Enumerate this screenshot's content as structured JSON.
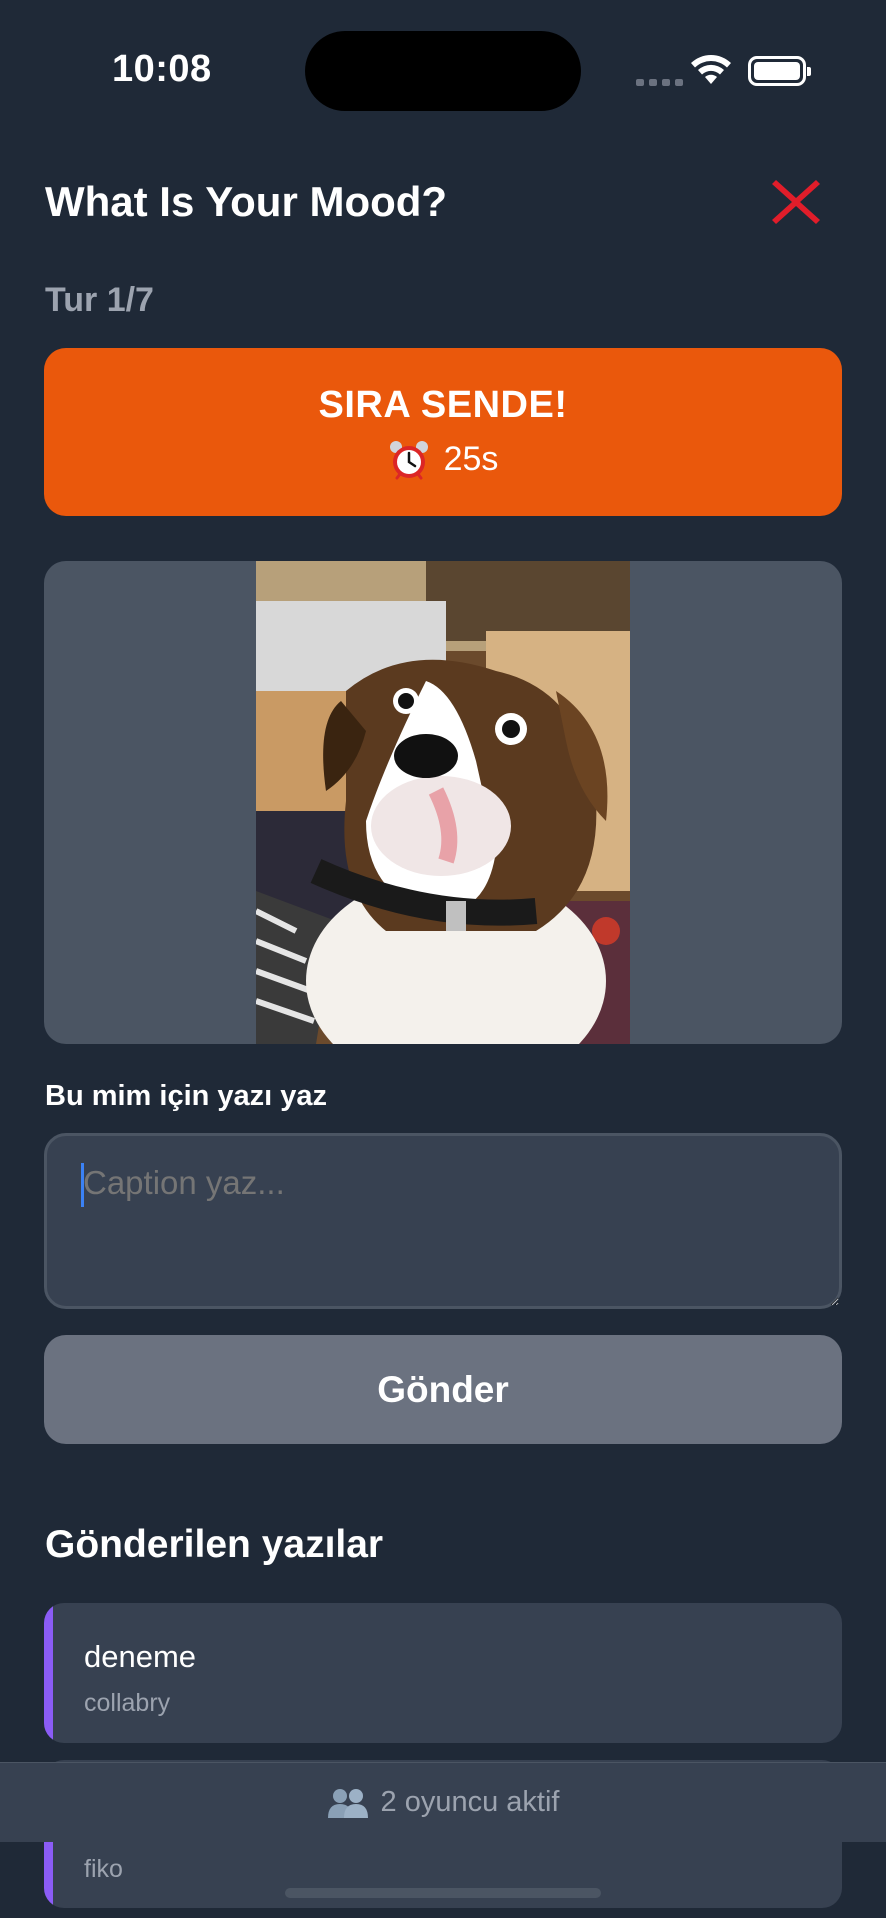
{
  "status_bar": {
    "time": "10:08"
  },
  "header": {
    "title": "What Is Your Mood?",
    "round": "Tur 1/7"
  },
  "turn": {
    "title": "SIRA SENDE!",
    "timer": "25s",
    "timer_icon": "alarm-clock-icon"
  },
  "meme": {
    "label": "Bu mim için yazı yaz"
  },
  "caption_input": {
    "placeholder": "Caption yaz...",
    "value": ""
  },
  "send_button": {
    "label": "Gönder"
  },
  "submitted": {
    "title": "Gönderilen yazılar",
    "items": [
      {
        "text": "deneme",
        "author": "collabry"
      },
      {
        "text": "",
        "author": "fiko"
      }
    ]
  },
  "footer": {
    "players": "2 oyuncu aktif",
    "icon": "users-icon"
  },
  "colors": {
    "background": "#1f2937",
    "accent_orange": "#ea580c",
    "close_red": "#e11d2a",
    "card_accent": "#8b5cf6"
  }
}
